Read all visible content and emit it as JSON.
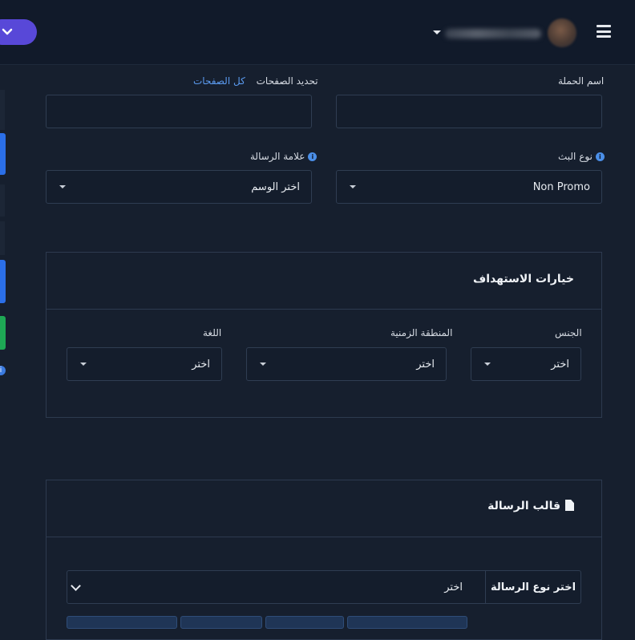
{
  "topbar": {
    "menu_icon": "hamburger-icon",
    "lang_label": "ع",
    "lang_icon": "chevron-down-icon"
  },
  "form": {
    "campaign_name_label": "اسم الحملة",
    "pages_label": "تحديد الصفحات",
    "all_pages_link": "كل الصفحات",
    "broadcast_type_label": "نوع البث",
    "broadcast_type_value": "Non Promo",
    "message_tag_label": "علامة الرسالة",
    "message_tag_value": "اختر الوسم"
  },
  "targeting": {
    "title": "خيارات الاستهداف",
    "gender_label": "الجنس",
    "gender_value": "اختر",
    "timezone_label": "المنطقة الزمنية",
    "timezone_value": "اختر",
    "language_label": "اللغة",
    "language_value": "اختر"
  },
  "template": {
    "title": "قالب الرسالة",
    "icon": "document-icon",
    "message_type_label": "اختر نوع الرسالة",
    "message_type_value": "اختر"
  },
  "colors": {
    "background": "#161f2e",
    "topbar": "#111a2a",
    "accent_purple": "#5848d8",
    "link_blue": "#5b9bf0",
    "sidebar_blue": "#2b6fe8",
    "sidebar_green": "#1ea855"
  }
}
